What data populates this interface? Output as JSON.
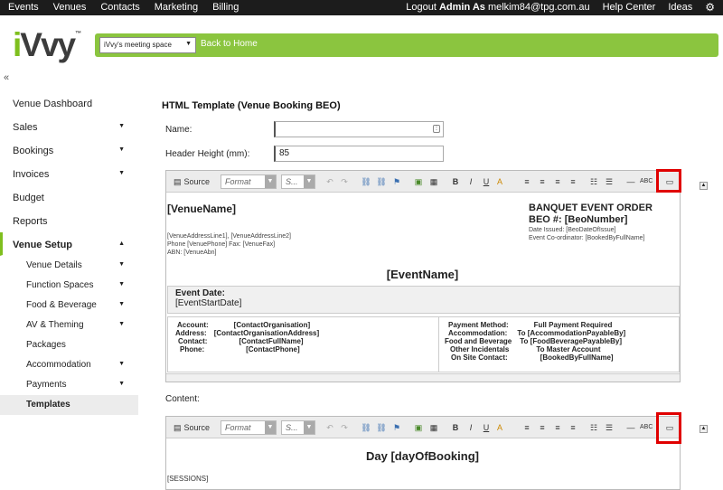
{
  "topnav": {
    "items": [
      "Events",
      "Venues",
      "Contacts",
      "Marketing",
      "Billing"
    ],
    "logout_prefix": "Logout",
    "admin_as": "Admin As",
    "email": "melkim84@tpg.com.au",
    "help": "Help Center",
    "ideas": "Ideas"
  },
  "brand": {
    "logo": "iVvy"
  },
  "greenbar": {
    "space_select": "iVvy's meeting space",
    "back": "Back to Home"
  },
  "collapse_icon": "«",
  "sidebar": {
    "items": [
      {
        "label": "Venue Dashboard",
        "caret": false
      },
      {
        "label": "Sales",
        "caret": true
      },
      {
        "label": "Bookings",
        "caret": true
      },
      {
        "label": "Invoices",
        "caret": true
      },
      {
        "label": "Budget",
        "caret": false
      },
      {
        "label": "Reports",
        "caret": false
      },
      {
        "label": "Venue Setup",
        "caret": true,
        "active": true
      }
    ],
    "subitems": [
      {
        "label": "Venue Details",
        "caret": true
      },
      {
        "label": "Function Spaces",
        "caret": true
      },
      {
        "label": "Food & Beverage",
        "caret": true
      },
      {
        "label": "AV & Theming",
        "caret": true
      },
      {
        "label": "Packages",
        "caret": false
      },
      {
        "label": "Accommodation",
        "caret": true
      },
      {
        "label": "Payments",
        "caret": true
      },
      {
        "label": "Templates",
        "caret": false,
        "selected": true
      }
    ]
  },
  "page": {
    "title": "HTML Template (Venue Booking BEO)",
    "name_label": "Name:",
    "name_value": "",
    "header_label": "Header Height (mm):",
    "header_value": "85",
    "content_label": "Content:"
  },
  "toolbar": {
    "source": "Source",
    "format": "Format",
    "styles": "S..."
  },
  "header_doc": {
    "venue_name": "[VenueName]",
    "address": "[VenueAddressLine1], [VenueAddressLine2]",
    "phone": "Phone [VenuePhone] Fax: [VenueFax]",
    "abn": "ABN: [VenueAbn]",
    "beo_title": "BANQUET EVENT ORDER",
    "beo_num": "BEO #: [BeoNumber]",
    "date_issued": "Date Issued: [BeoDateOfIssue]",
    "coordinator": "Event Co-ordinator: [BookedByFullName]",
    "event_name": "[EventName]",
    "event_date_label": "Event Date:",
    "event_date_value": "[EventStartDate]",
    "left_rows": [
      {
        "k": "Account:",
        "v": "[ContactOrganisation]"
      },
      {
        "k": "Address:",
        "v": "[ContactOrganisationAddress]"
      },
      {
        "k": "Contact:",
        "v": "[ContactFullName]"
      },
      {
        "k": "Phone:",
        "v": "[ContactPhone]"
      }
    ],
    "right_rows": [
      {
        "k": "Payment Method:",
        "v": "Full Payment Required"
      },
      {
        "k": "Accommodation:",
        "v": "To [AccommodationPayableBy]"
      },
      {
        "k": "Food and Beverage",
        "v": "To [FoodBeveragePayableBy]"
      },
      {
        "k": "Other Incidentals",
        "v": "To Master Account"
      },
      {
        "k": "On Site Contact:",
        "v": "[BookedByFullName]"
      }
    ]
  },
  "content_doc": {
    "day": "Day [dayOfBooking]",
    "sessions": "[SESSIONS]"
  },
  "colors": {
    "brand_green": "#8bc53f",
    "highlight": "#e00000"
  }
}
